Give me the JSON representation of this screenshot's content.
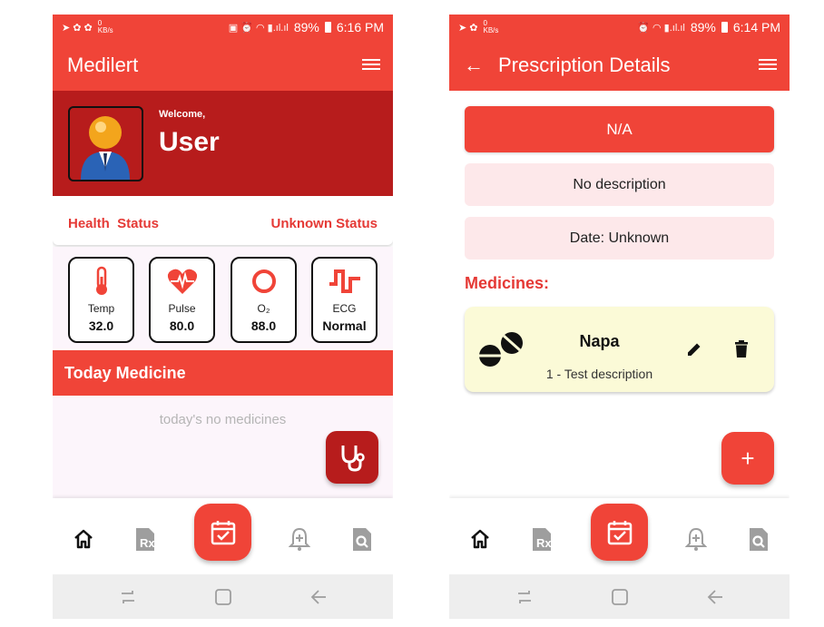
{
  "colors": {
    "primary": "#f04438",
    "dark_red": "#b71c1c",
    "light_pink": "#fde8ea",
    "light_yellow": "#fbfad7"
  },
  "screen1": {
    "status": {
      "time": "6:16 PM",
      "battery": "89%",
      "speed": "0\nKB/s"
    },
    "app_title": "Medilert",
    "welcome_label": "Welcome,",
    "user_name": "User",
    "health_label": "Health  Status",
    "health_value": "Unknown Status",
    "vitals": [
      {
        "icon": "thermometer-icon",
        "name": "Temp",
        "value": "32.0"
      },
      {
        "icon": "heart-pulse-icon",
        "name": "Pulse",
        "value": "80.0"
      },
      {
        "icon": "oxygen-ring-icon",
        "name": "O₂",
        "value": "88.0"
      },
      {
        "icon": "ecg-wave-icon",
        "name": "ECG",
        "value": "Normal"
      }
    ],
    "today_medicine_title": "Today Medicine",
    "today_empty_text": "today's no medicines"
  },
  "screen2": {
    "status": {
      "time": "6:14 PM",
      "battery": "89%",
      "speed": "0\nKB/s"
    },
    "app_title": "Prescription Details",
    "prescription_title": "N/A",
    "description": "No description",
    "date": "Date: Unknown",
    "medicines_heading": "Medicines:",
    "medicines": [
      {
        "name": "Napa",
        "detail": "1 - Test description"
      }
    ],
    "add_label": "+"
  },
  "bottom_nav": [
    "home-icon",
    "prescription-icon",
    "calendar-check-icon",
    "reminder-bell-icon",
    "search-document-icon"
  ]
}
